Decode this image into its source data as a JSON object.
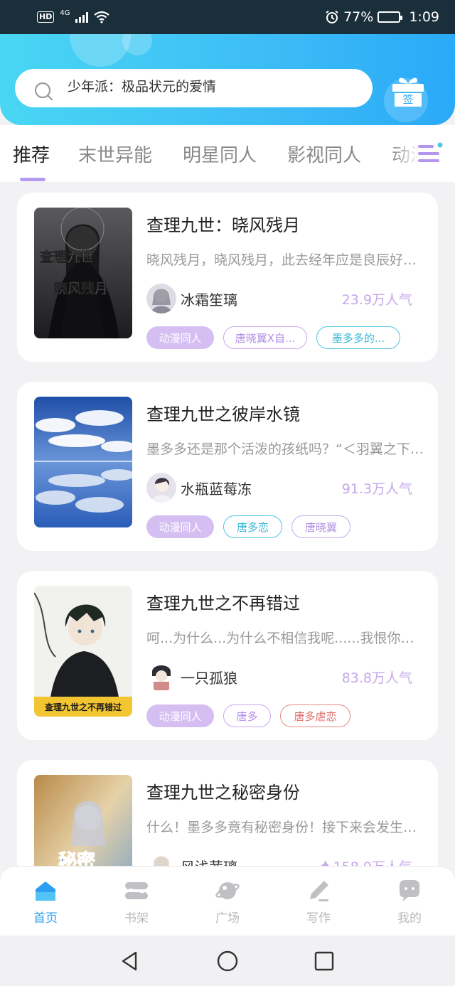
{
  "status_bar": {
    "network": "4G",
    "battery": "77%",
    "time": "1:09",
    "battery_level": 0.77
  },
  "search": {
    "text": "少年派：极品状元的爱情"
  },
  "sign_button": {
    "label": "签"
  },
  "tabs": [
    {
      "label": "推荐",
      "active": true
    },
    {
      "label": "末世异能"
    },
    {
      "label": "明星同人"
    },
    {
      "label": "影视同人"
    },
    {
      "label": "动漫"
    }
  ],
  "books": [
    {
      "title": "查理九世：晓风残月",
      "desc": "晓风残月，晓风残月，此去经年应是良辰好景虚设。",
      "author": "冰霜笙璃",
      "popularity": "23.9万人气",
      "tags": [
        "动漫同人",
        "唐晓翼X自...",
        "墨多多的..."
      ],
      "cover_text": "查理九世",
      "cover_sub": "晓风残月"
    },
    {
      "title": "查理九世之彼岸水镜",
      "desc": "墨多多还是那个活泼的孩纸吗？“＜羽翼之下的梦”",
      "author": "水瓶蓝莓冻",
      "popularity": "91.3万人气",
      "tags": [
        "动漫同人",
        "唐多恋",
        "唐晓翼"
      ]
    },
    {
      "title": "查理九世之不再错过",
      "desc": "呵...为什么...为什么不相信我呢......我恨你们！",
      "author": "一只孤狼",
      "popularity": "83.8万人气",
      "tags": [
        "动漫同人",
        "唐多",
        "唐多虐恋"
      ],
      "cover_text": "查理九世之不再错过"
    },
    {
      "title": "查理九世之秘密身份",
      "desc": "什么！墨多多竟有秘密身份！接下来会发生什么呢？",
      "author": "风浅茜璃",
      "popularity": "158.9万人气",
      "tags": [],
      "cover_text": "秘密"
    }
  ],
  "bottom_nav": [
    {
      "label": "首页",
      "icon": "home-icon",
      "active": true
    },
    {
      "label": "书架",
      "icon": "bookshelf-icon"
    },
    {
      "label": "广场",
      "icon": "planet-icon"
    },
    {
      "label": "写作",
      "icon": "write-icon"
    },
    {
      "label": "我的",
      "icon": "chat-bubble-icon"
    }
  ],
  "colors": {
    "accent": "#2d9ff0",
    "header_start": "#49d6f3",
    "header_end": "#2aa9f8",
    "tab_underline": "#b59bf0",
    "popularity": "#c6a8ec"
  }
}
